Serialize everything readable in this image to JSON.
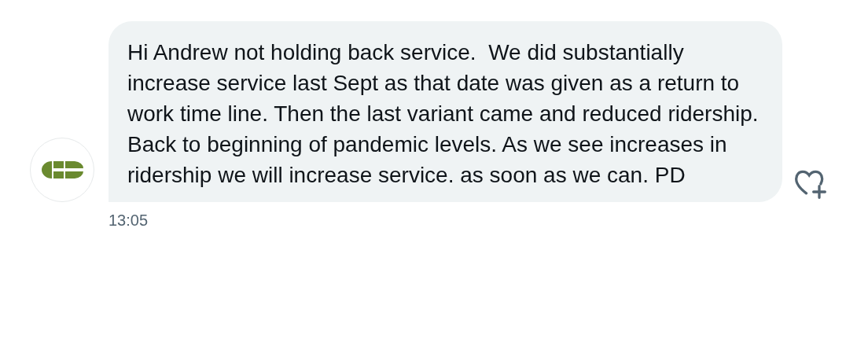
{
  "message": {
    "text": "Hi Andrew not holding back service.  We did substantially increase service last Sept as that date was given as a return to work time line. Then the last variant came and reduced ridership. Back to beginning of pandemic levels. As we see increases in ridership we will increase service. as soon as we can. PD",
    "time": "13:05"
  }
}
